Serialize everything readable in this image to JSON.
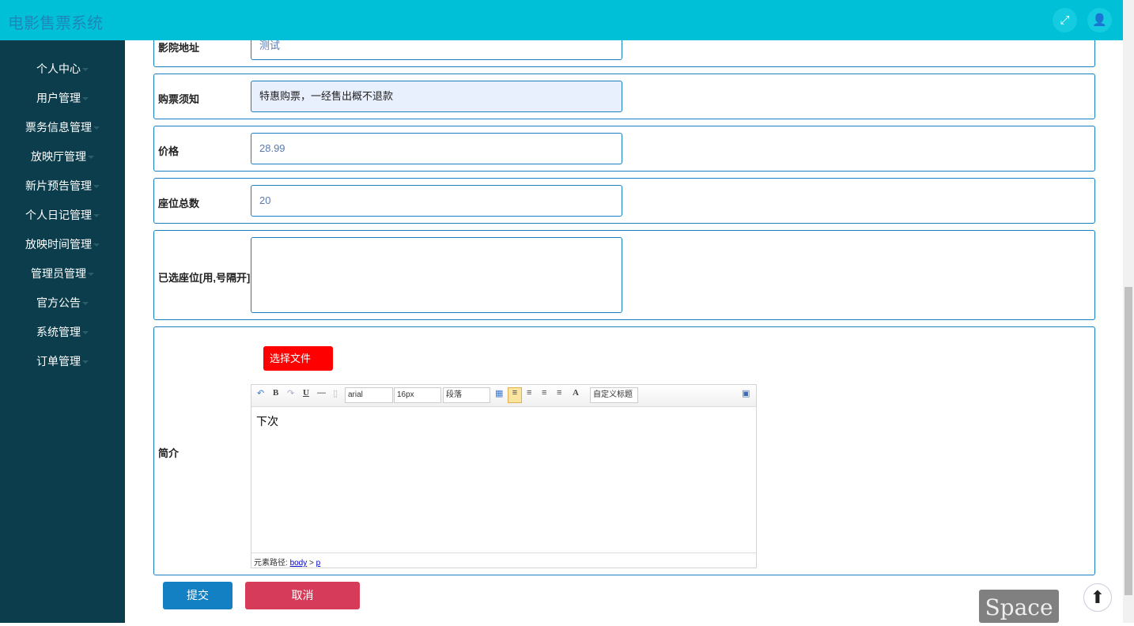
{
  "header": {
    "title": "电影售票系统",
    "fullscreen_icon": "expand-icon",
    "user_icon": "user-icon"
  },
  "sidebar": {
    "items": [
      {
        "label": "个人中心"
      },
      {
        "label": "用户管理"
      },
      {
        "label": "票务信息管理"
      },
      {
        "label": "放映厅管理"
      },
      {
        "label": "新片预告管理"
      },
      {
        "label": "个人日记管理"
      },
      {
        "label": "放映时间管理"
      },
      {
        "label": "管理员管理"
      },
      {
        "label": "官方公告"
      },
      {
        "label": "系统管理"
      },
      {
        "label": "订单管理"
      }
    ]
  },
  "form": {
    "address": {
      "label": "影院地址",
      "value": "测试"
    },
    "notice": {
      "label": "购票须知",
      "value": "特惠购票，一经售出概不退款"
    },
    "price": {
      "label": "价格",
      "value": "28.99"
    },
    "seats": {
      "label": "座位总数",
      "value": "20"
    },
    "selected": {
      "label": "已选座位[用,号隔开]",
      "value": ""
    },
    "intro": {
      "label": "简介",
      "upload_label": "选择文件",
      "content": "下次",
      "toolbar": {
        "font": "arial",
        "size": "16px",
        "paragraph": "段落",
        "heading": "自定义标题",
        "bold": "B",
        "underline": "U",
        "fontcolor": "A"
      },
      "path_label": "元素路径:",
      "path_body": "body",
      "path_sep": ">",
      "path_p": "p"
    }
  },
  "buttons": {
    "submit": "提交",
    "cancel": "取消"
  },
  "overlay": {
    "space": "Space"
  }
}
